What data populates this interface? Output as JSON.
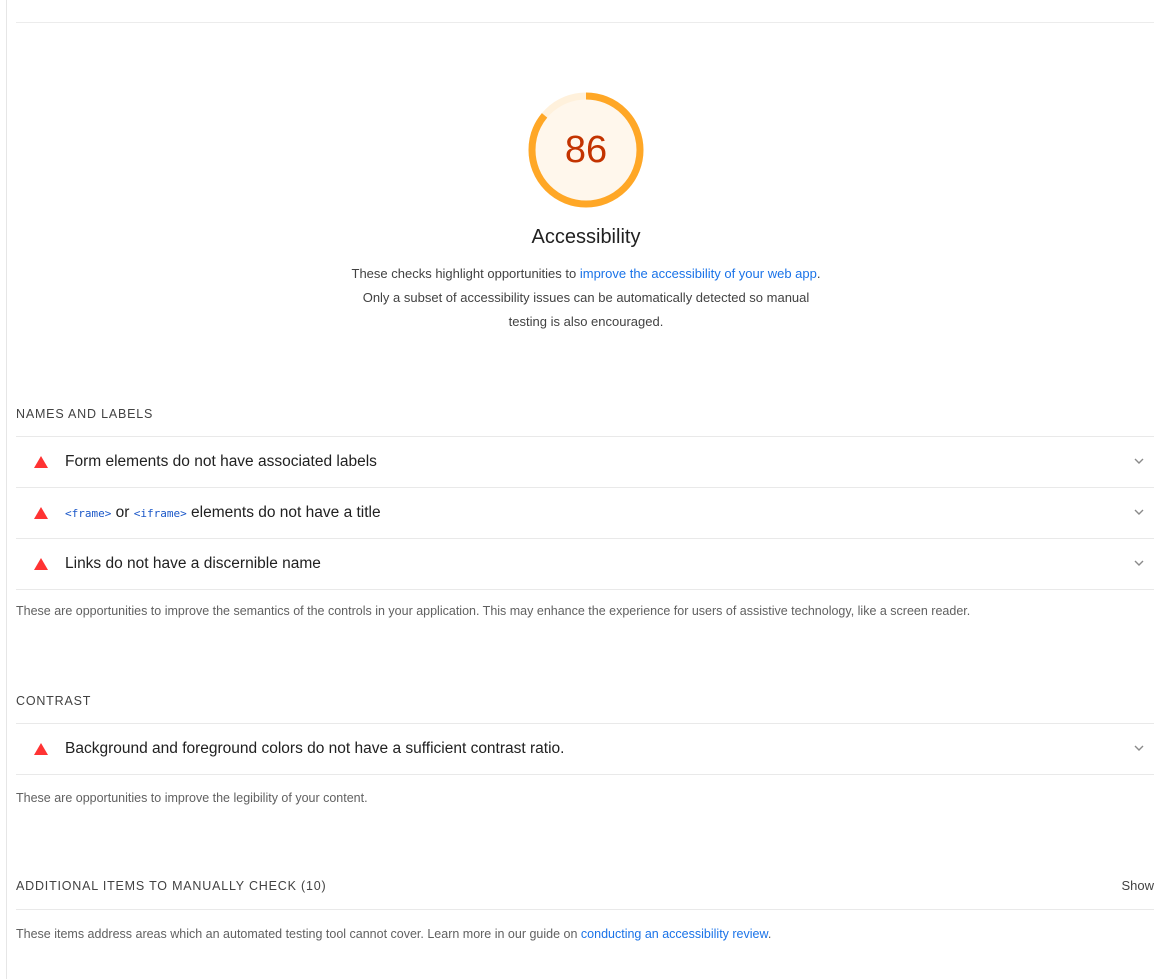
{
  "gauge": {
    "score": "86",
    "fraction": 0.86,
    "arc_color": "#ffa726",
    "track_color": "#fff3e0",
    "score_color": "#c33300"
  },
  "category": {
    "title": "Accessibility",
    "desc_before": "These checks highlight opportunities to ",
    "desc_link": "improve the accessibility of your web app",
    "desc_after": ". Only a subset of accessibility issues can be automatically detected so manual testing is also encouraged."
  },
  "groups": {
    "names_labels": {
      "title": "NAMES AND LABELS",
      "audits": [
        {
          "title": "Form elements do not have associated labels"
        },
        {
          "code1": "<frame>",
          "mid": " or ",
          "code2": "<iframe>",
          "rest": " elements do not have a title"
        },
        {
          "title": "Links do not have a discernible name"
        }
      ],
      "description": "These are opportunities to improve the semantics of the controls in your application. This may enhance the experience for users of assistive technology, like a screen reader."
    },
    "contrast": {
      "title": "CONTRAST",
      "audits": [
        {
          "title": "Background and foreground colors do not have a sufficient contrast ratio."
        }
      ],
      "description": "These are opportunities to improve the legibility of your content."
    },
    "manual": {
      "title": "ADDITIONAL ITEMS TO MANUALLY CHECK (10)",
      "toggle_label": "Show",
      "desc_before": "These items address areas which an automated testing tool cannot cover. Learn more in our guide on ",
      "desc_link": "conducting an accessibility review",
      "desc_after": "."
    }
  },
  "colors": {
    "fail": "#ff3333",
    "link": "#1a73e8",
    "chevron": "#8a8a8a"
  }
}
